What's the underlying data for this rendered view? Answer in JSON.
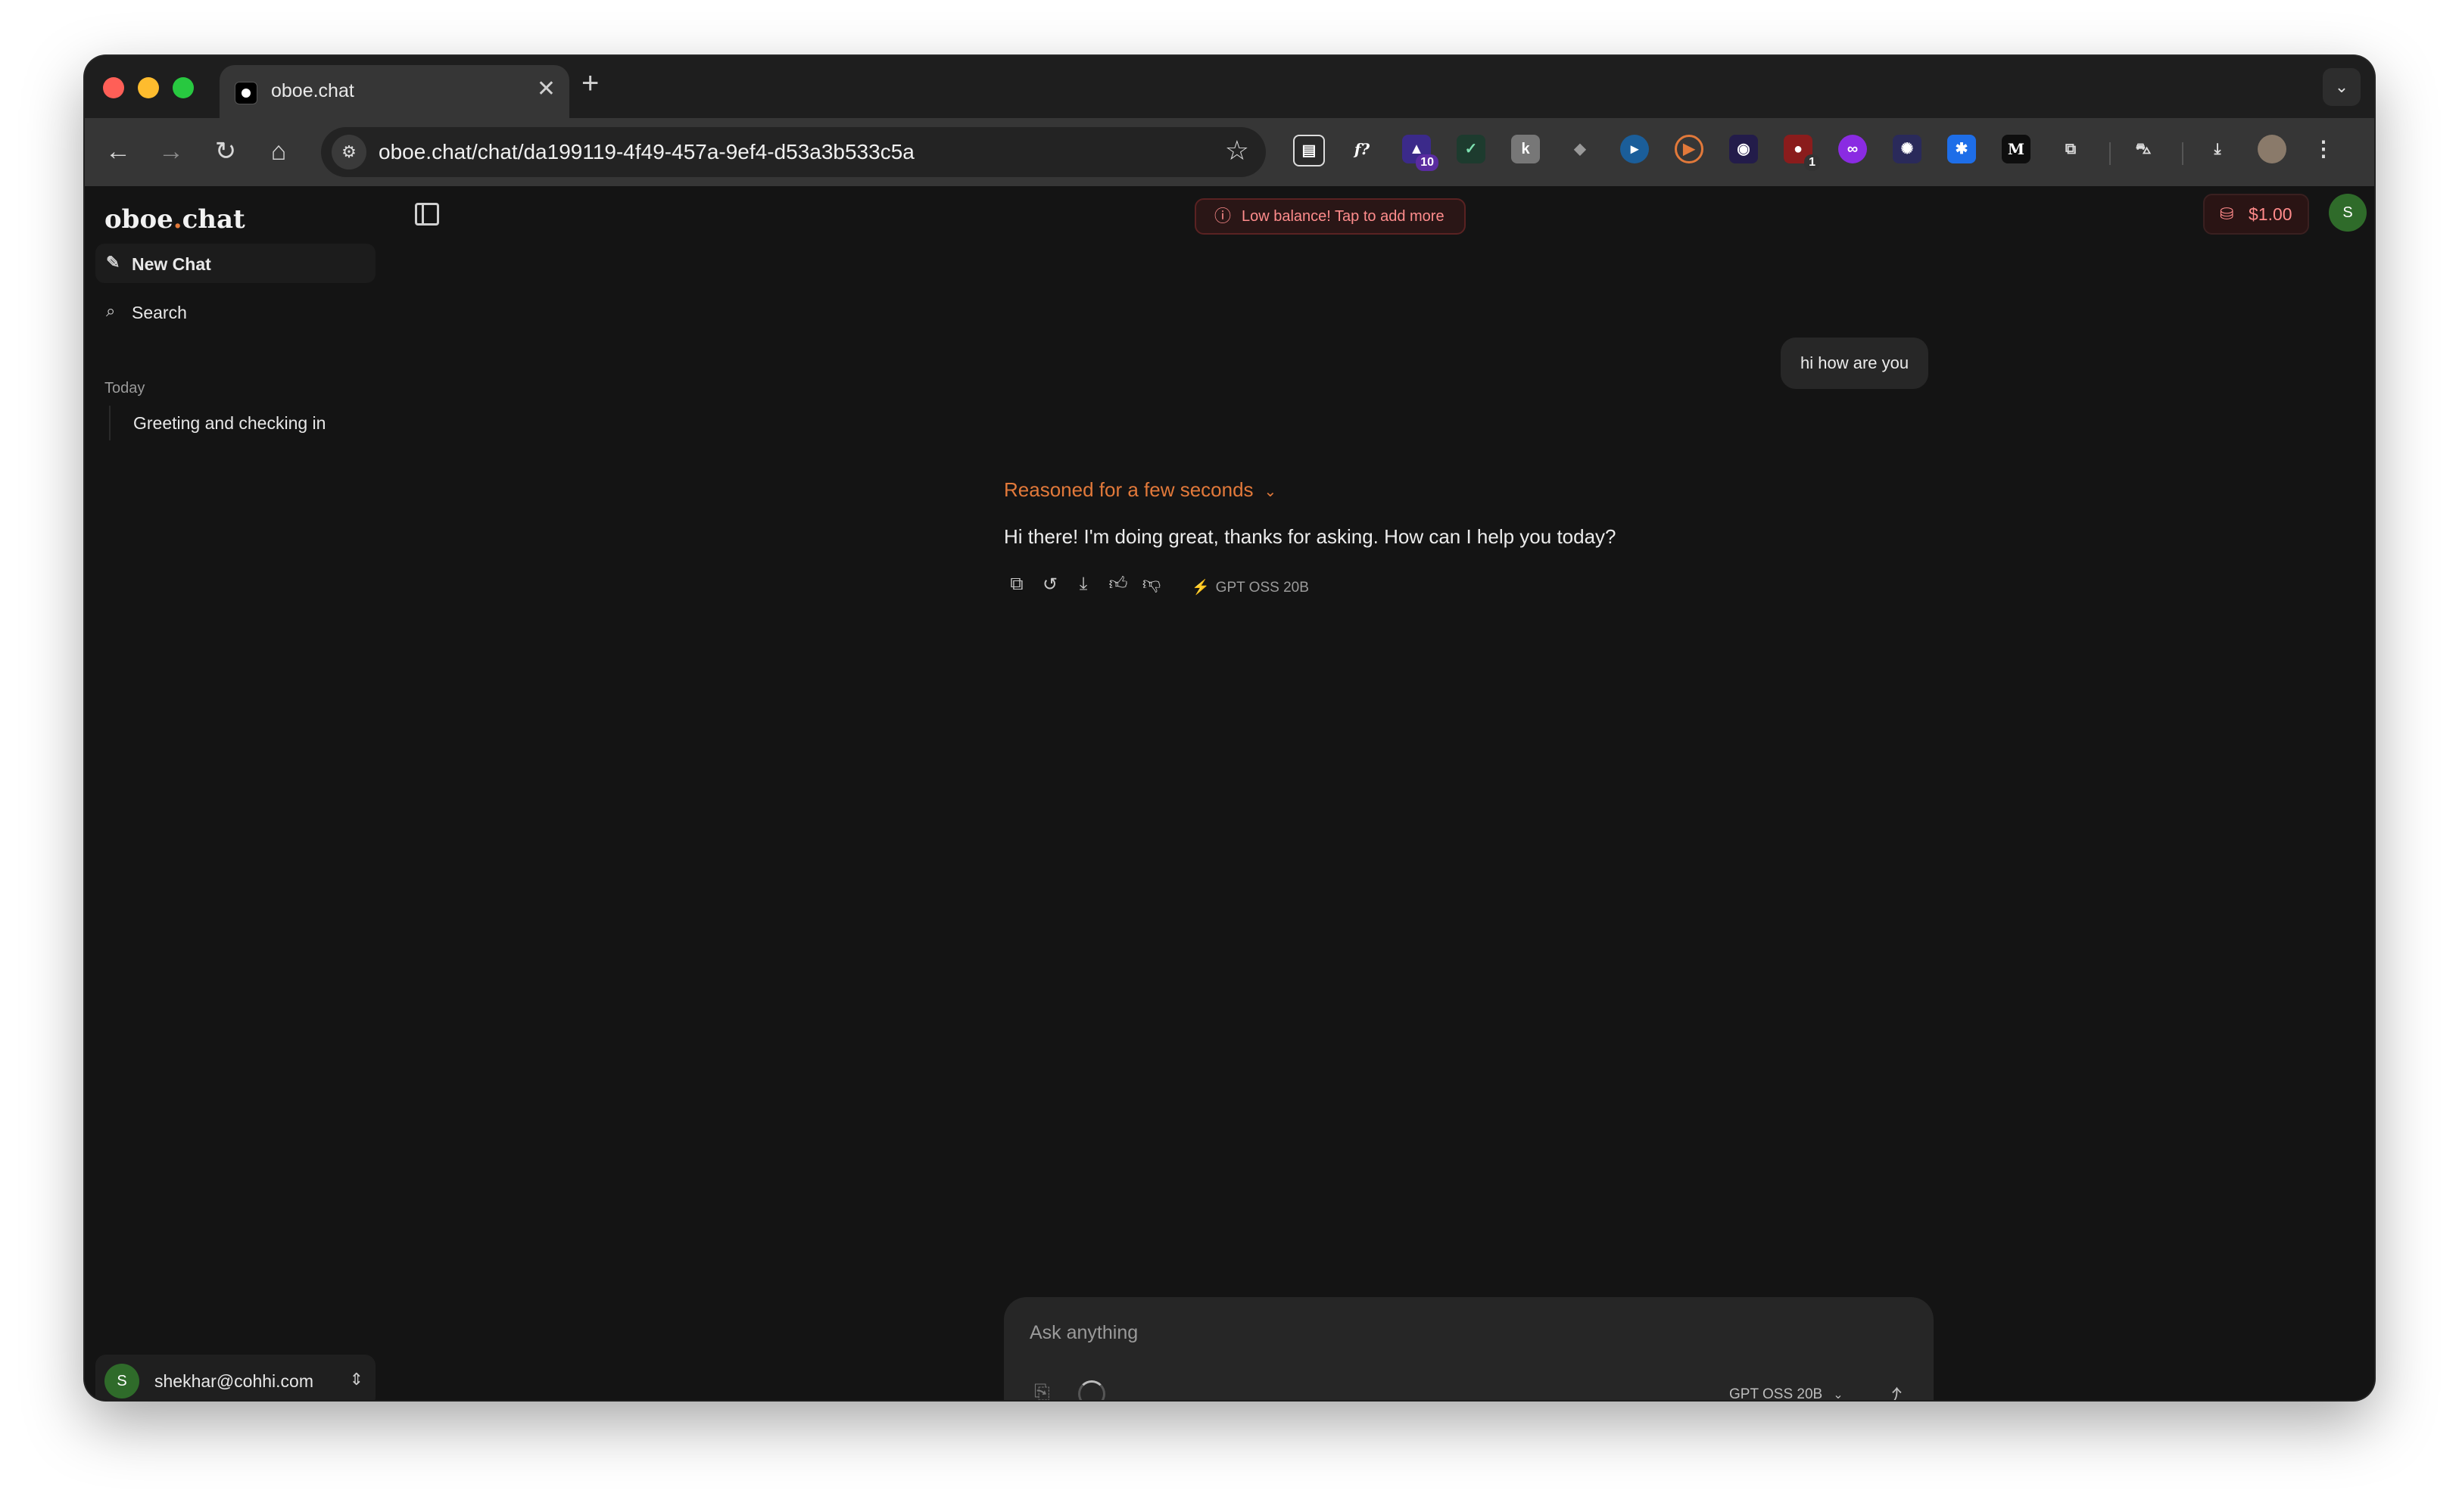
{
  "browser": {
    "tab_title": "oboe.chat",
    "tab_close": "✕",
    "new_tab": "+",
    "url": "oboe.chat/chat/da199119-4f49-457a-9ef4-d53a3b533c5a",
    "extension_badges": {
      "ext_10": "10",
      "ext_1": "1"
    }
  },
  "sidebar": {
    "logo_main": "oboe",
    "logo_dot": ".",
    "logo_suffix": "chat",
    "new_chat_label": "New Chat",
    "search_label": "Search",
    "section_today": "Today",
    "history": [
      {
        "title": "Greeting and checking in"
      }
    ],
    "account_initial": "S",
    "account_email": "shekhar@cohhi.com"
  },
  "header": {
    "low_balance_text": "Low balance! Tap to add more",
    "balance": "$1.00",
    "avatar_initial": "S"
  },
  "chat": {
    "user_message": "hi how are you",
    "reasoned_label": "Reasoned for a few seconds",
    "assistant_message": "Hi there! I'm doing great, thanks for asking. How can I help you today?",
    "model_tag": "GPT OSS 20B"
  },
  "composer": {
    "placeholder": "Ask anything",
    "model_label": "GPT OSS 20B"
  },
  "colors": {
    "accent": "#e2793a",
    "background": "#141414",
    "warning": "#ff8c8c",
    "avatar": "#2f6b2a"
  }
}
